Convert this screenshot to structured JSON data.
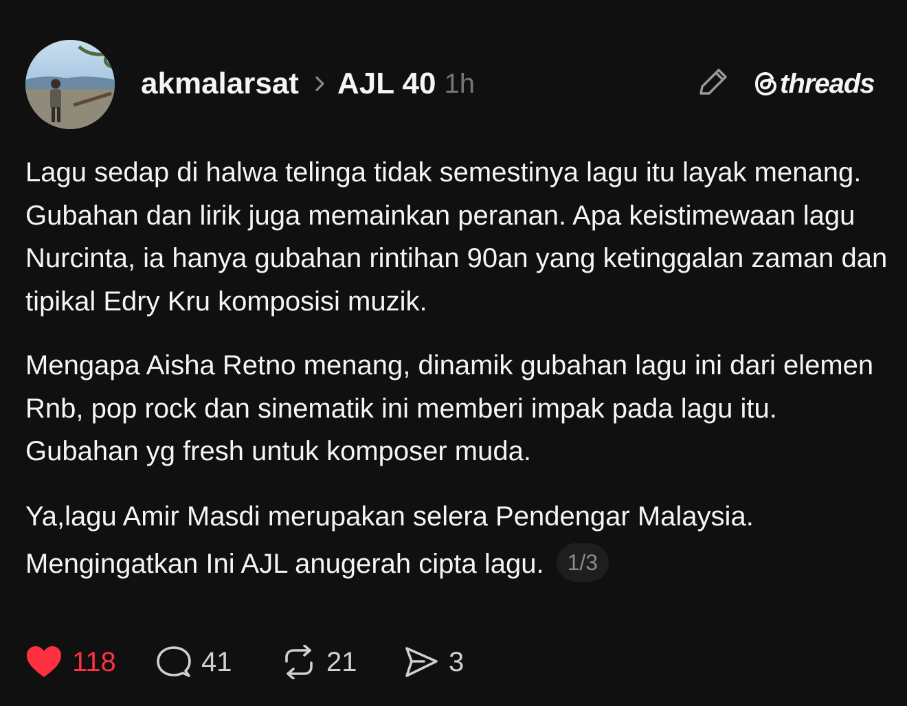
{
  "post": {
    "author": {
      "username": "akmalarsat"
    },
    "topic": "AJL 40",
    "time": "1h",
    "brand": "threads",
    "paragraphs": [
      "Lagu sedap di halwa telinga tidak semestinya lagu itu layak menang. Gubahan dan lirik juga memainkan peranan. Apa keistimewaan lagu Nurcinta, ia hanya gubahan rintihan 90an yang ketinggalan zaman dan tipikal Edry Kru komposisi muzik.",
      "Mengapa Aisha Retno menang, dinamik gubahan lagu ini dari elemen Rnb, pop rock dan sinematik ini memberi impak pada lagu itu. Gubahan yg fresh untuk komposer muda.",
      "Ya,lagu Amir Masdi merupakan selera Pendengar Malaysia. Mengingatkan Ini AJL anugerah cipta lagu."
    ],
    "page_indicator": "1/3",
    "actions": {
      "likes": "118",
      "replies": "41",
      "reposts": "21",
      "shares": "3",
      "liked": true
    }
  },
  "icons": {
    "avatar": "avatar-photo",
    "chevron": "chevron-right-icon",
    "edit": "pencil-icon",
    "brand": "threads-logo-icon",
    "like": "heart-icon",
    "reply": "comment-bubble-icon",
    "repost": "repost-icon",
    "share": "send-icon"
  },
  "colors": {
    "background": "#101010",
    "text": "#f3f5f7",
    "muted": "#777777",
    "like": "#ff3040"
  }
}
